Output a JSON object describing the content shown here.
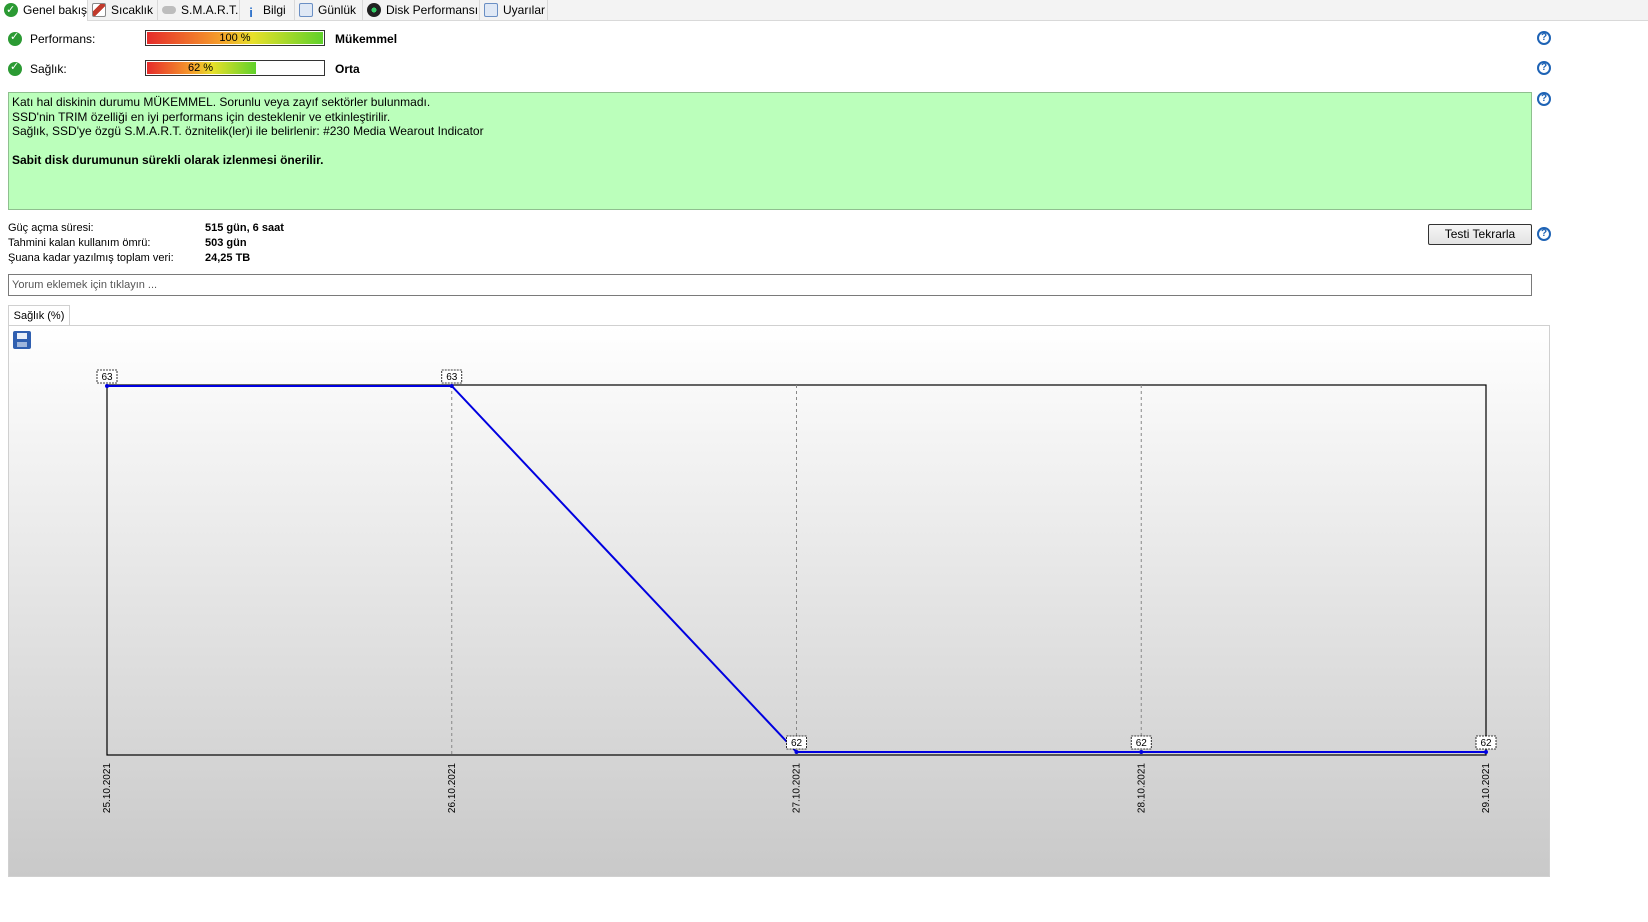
{
  "tabs": [
    {
      "label": "Genel bakış",
      "icon": "check-icon"
    },
    {
      "label": "Sıcaklık",
      "icon": "thermometer-icon"
    },
    {
      "label": "S.M.A.R.T.",
      "icon": "smart-icon"
    },
    {
      "label": "Bilgi",
      "icon": "info-icon"
    },
    {
      "label": "Günlük",
      "icon": "log-icon"
    },
    {
      "label": "Disk Performansı",
      "icon": "gauge-icon"
    },
    {
      "label": "Uyarılar",
      "icon": "document-icon"
    }
  ],
  "performance": {
    "label": "Performans:",
    "percent_text": "100 %",
    "value": 100,
    "verdict": "Mükemmel"
  },
  "health": {
    "label": "Sağlık:",
    "percent_text": "62 %",
    "value": 62,
    "verdict": "Orta"
  },
  "message": {
    "line1": "Katı hal diskinin durumu MÜKEMMEL. Sorunlu veya zayıf sektörler bulunmadı.",
    "line2": "SSD'nin TRIM özelliği en iyi performans için desteklenir ve etkinleştirilir.",
    "line3": "Sağlık, SSD'ye özgü S.M.A.R.T. öznitelik(ler)i ile belirlenir:  #230 Media Wearout Indicator",
    "recommendation": "Sabit disk durumunun sürekli olarak izlenmesi önerilir."
  },
  "info": {
    "power_on_label": "Güç açma süresi:",
    "power_on_value": "515 gün, 6 saat",
    "remaining_label": "Tahmini kalan kullanım ömrü:",
    "remaining_value": "503 gün",
    "written_label": "Şuana kadar yazılmış toplam veri:",
    "written_value": "24,25 TB"
  },
  "retest_button": "Testi Tekrarla",
  "comment_placeholder": "Yorum eklemek için tıklayın ...",
  "chart_tab": "Sağlık (%)",
  "colors": {
    "line": "#0000e0",
    "message_bg": "#bbffbb",
    "check": "#2b9a33",
    "help": "#1e63b5"
  },
  "chart_data": {
    "type": "line",
    "x": [
      "25.10.2021",
      "26.10.2021",
      "27.10.2021",
      "28.10.2021",
      "29.10.2021"
    ],
    "series": [
      {
        "values": [
          63,
          63,
          62,
          62,
          62
        ]
      }
    ],
    "data_labels": [
      "63",
      "63",
      "62",
      "62",
      "62"
    ],
    "ylim": [
      62,
      63
    ],
    "grid": "vertical dashed"
  }
}
